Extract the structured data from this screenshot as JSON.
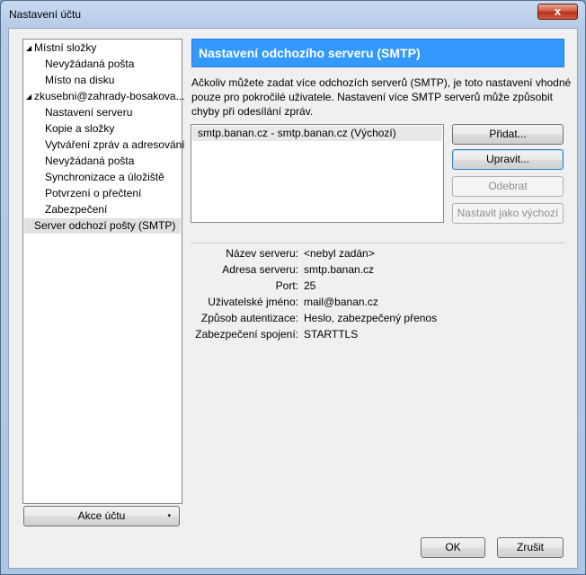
{
  "window": {
    "title": "Nastavení účtu",
    "close_glyph": "x"
  },
  "tree": {
    "items": [
      {
        "label": "Místní složky",
        "level": 0,
        "expanded": true
      },
      {
        "label": "Nevyžádaná pošta",
        "level": 1
      },
      {
        "label": "Místo na disku",
        "level": 1
      },
      {
        "label": "zkusebni@zahrady-bosakova...",
        "level": 0,
        "expanded": true
      },
      {
        "label": "Nastavení serveru",
        "level": 1
      },
      {
        "label": "Kopie a složky",
        "level": 1
      },
      {
        "label": "Vytváření zpráv a adresování",
        "level": 1
      },
      {
        "label": "Nevyžádaná pošta",
        "level": 1
      },
      {
        "label": "Synchronizace a úložiště",
        "level": 1
      },
      {
        "label": "Potvrzení o přečtení",
        "level": 1
      },
      {
        "label": "Zabezpečení",
        "level": 1
      },
      {
        "label": "Server odchozí pošty (SMTP)",
        "level": 0,
        "selected": true
      }
    ],
    "expand_glyph": "◢"
  },
  "account_actions": {
    "label": "Akce účtu",
    "arrow": "▾"
  },
  "smtp": {
    "title": "Nastavení odchozího serveru (SMTP)",
    "description_lines": [
      "Ačkoliv můžete zadat více odchozích serverů (SMTP), je toto nastavení vhodné",
      "pouze pro pokročilé uživatele. Nastavení více SMTP serverů může způsobit",
      "chyby při odesílání zpráv."
    ],
    "servers": [
      "smtp.banan.cz - smtp.banan.cz (Výchozí)"
    ],
    "buttons": {
      "add": "Přidat...",
      "edit": "Upravit...",
      "remove": "Odebrat",
      "set_default": "Nastavit jako výchozí"
    },
    "details": [
      {
        "label": "Název serveru:",
        "value": "<nebyl zadán>"
      },
      {
        "label": "Adresa serveru:",
        "value": "smtp.banan.cz"
      },
      {
        "label": "Port:",
        "value": "25"
      },
      {
        "label": "Uživatelské jméno:",
        "value": "mail@banan.cz"
      },
      {
        "label": "Způsob autentizace:",
        "value": "Heslo, zabezpečený přenos"
      },
      {
        "label": "Zabezpečení spojení:",
        "value": "STARTTLS"
      }
    ]
  },
  "footer": {
    "ok": "OK",
    "cancel": "Zrušit"
  }
}
